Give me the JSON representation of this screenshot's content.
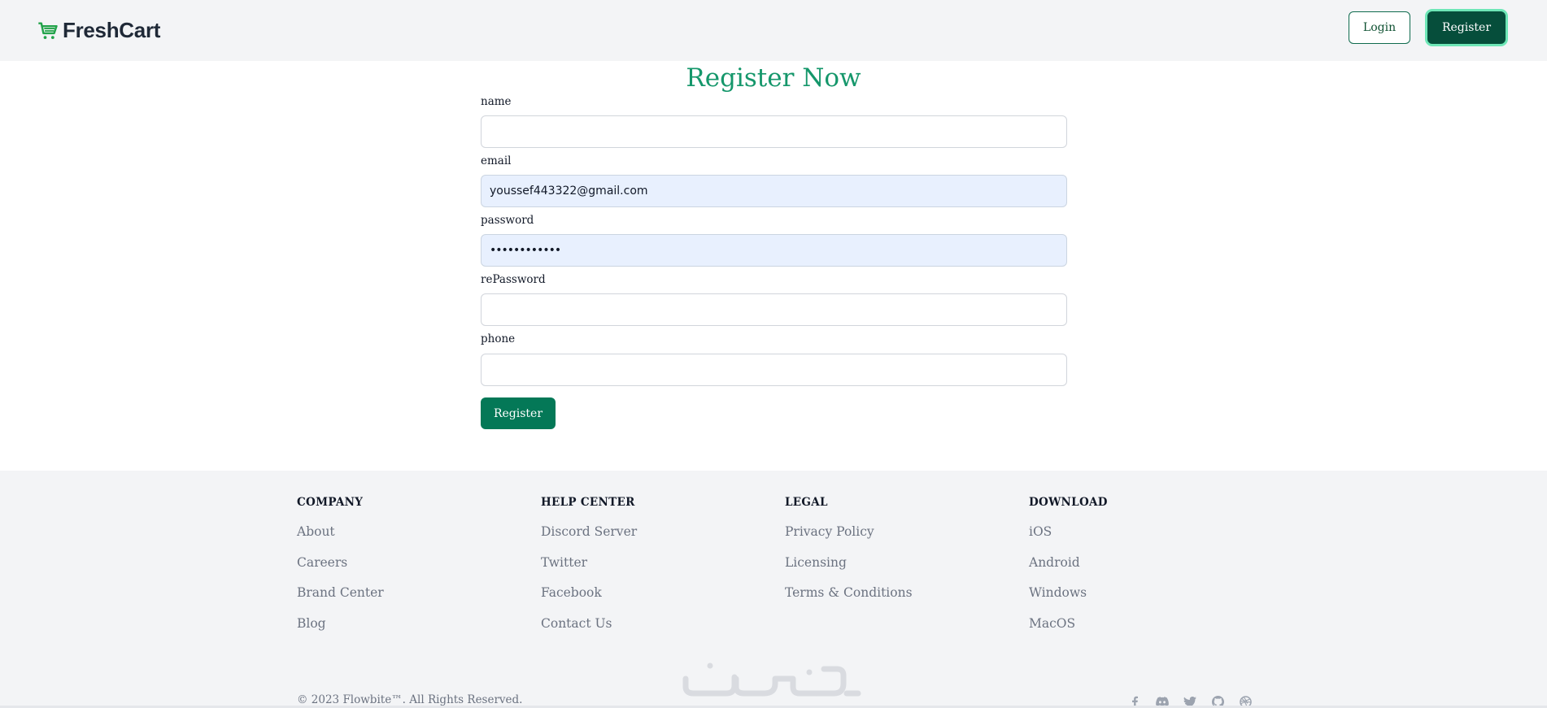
{
  "navbar": {
    "brand": "FreshCart",
    "login_label": "Login",
    "register_label": "Register"
  },
  "form": {
    "title": "Register Now",
    "fields": [
      {
        "label": "name",
        "value": ""
      },
      {
        "label": "email",
        "value": "youssef443322@gmail.com"
      },
      {
        "label": "password",
        "value": "••••••••••••"
      },
      {
        "label": "rePassword",
        "value": ""
      },
      {
        "label": "phone",
        "value": ""
      }
    ],
    "submit_label": "Register"
  },
  "footer": {
    "columns": [
      {
        "heading": "COMPANY",
        "links": [
          "About",
          "Careers",
          "Brand Center",
          "Blog"
        ]
      },
      {
        "heading": "HELP CENTER",
        "links": [
          "Discord Server",
          "Twitter",
          "Facebook",
          "Contact Us"
        ]
      },
      {
        "heading": "LEGAL",
        "links": [
          "Privacy Policy",
          "Licensing",
          "Terms & Conditions"
        ]
      },
      {
        "heading": "DOWNLOAD",
        "links": [
          "iOS",
          "Android",
          "Windows",
          "MacOS"
        ]
      }
    ],
    "copyright": "© 2023 Flowbite™. All Rights Reserved.",
    "watermark": "خمسات",
    "socials": [
      "facebook-icon",
      "discord-icon",
      "twitter-icon",
      "github-icon",
      "dribbble-icon"
    ]
  },
  "colors": {
    "brand_green": "#15976b",
    "dark_green": "#064e3b",
    "button_green": "#047857",
    "autofill_bg": "#e8f0fe"
  }
}
